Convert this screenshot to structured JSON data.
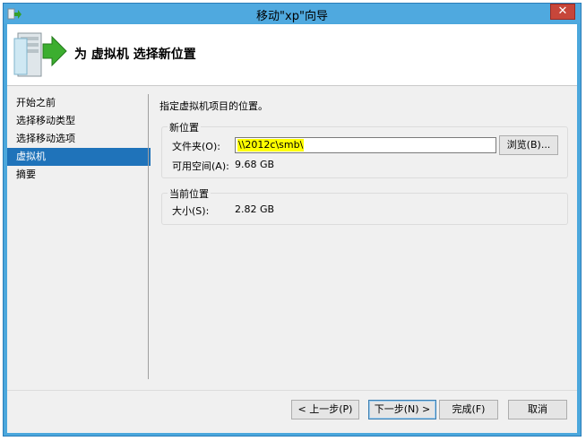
{
  "window": {
    "title": "移动\"xp\"向导",
    "close_label": "✕"
  },
  "header": {
    "title": "为 虚拟机 选择新位置",
    "icon": "server-arrow-icon"
  },
  "nav": {
    "items": [
      {
        "label": "开始之前",
        "selected": false
      },
      {
        "label": "选择移动类型",
        "selected": false
      },
      {
        "label": "选择移动选项",
        "selected": false
      },
      {
        "label": "虚拟机",
        "selected": true
      },
      {
        "label": "摘要",
        "selected": false
      }
    ]
  },
  "main": {
    "instruction": "指定虚拟机项目的位置。",
    "new_location": {
      "title": "新位置",
      "folder_label": "文件夹(O):",
      "folder_value": "\\\\2012c\\smb\\",
      "browse_label": "浏览(B)...",
      "free_space_label": "可用空间(A):",
      "free_space_value": "9.68 GB"
    },
    "current_location": {
      "title": "当前位置",
      "size_label": "大小(S):",
      "size_value": "2.82 GB"
    }
  },
  "footer": {
    "prev_label": "< 上一步(P)",
    "next_label": "下一步(N) >",
    "finish_label": "完成(F)",
    "cancel_label": "取消"
  },
  "colors": {
    "titlebar": "#4fa9df",
    "selection": "#1f73ba",
    "highlight": "#ffff00"
  }
}
